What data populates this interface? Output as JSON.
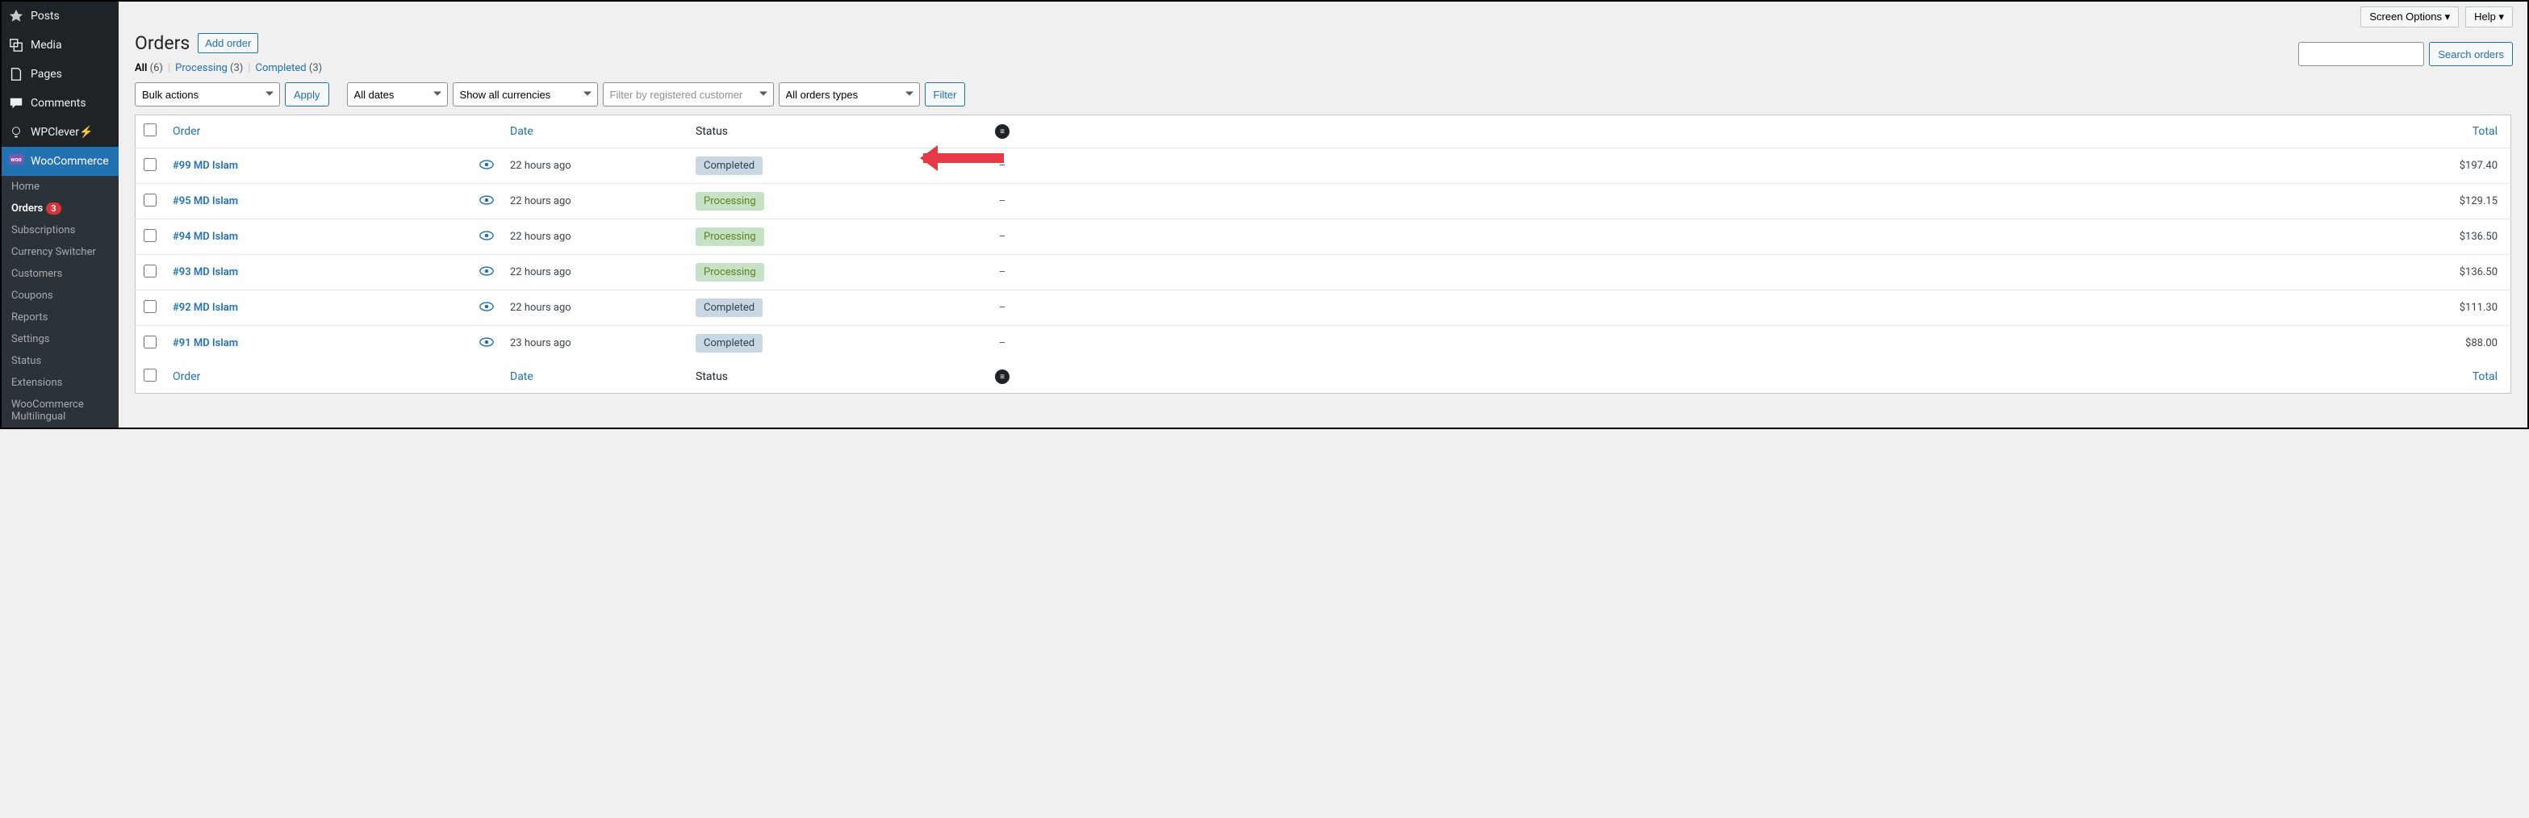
{
  "topbar": {
    "screen_options": "Screen Options ▾",
    "help": "Help ▾"
  },
  "sidebar": {
    "items": [
      {
        "label": "Posts",
        "icon": "pin-icon"
      },
      {
        "label": "Media",
        "icon": "media-icon"
      },
      {
        "label": "Pages",
        "icon": "pages-icon"
      },
      {
        "label": "Comments",
        "icon": "comment-icon"
      },
      {
        "label": "WPClever⚡",
        "icon": "bulb-icon"
      },
      {
        "label": "WooCommerce",
        "icon": "woo-icon",
        "active": true
      }
    ],
    "sub": [
      {
        "label": "Home"
      },
      {
        "label": "Orders",
        "current": true,
        "badge": "3"
      },
      {
        "label": "Subscriptions"
      },
      {
        "label": "Currency Switcher"
      },
      {
        "label": "Customers"
      },
      {
        "label": "Coupons"
      },
      {
        "label": "Reports"
      },
      {
        "label": "Settings"
      },
      {
        "label": "Status"
      },
      {
        "label": "Extensions"
      },
      {
        "label": "WooCommerce Multilingual"
      }
    ]
  },
  "header": {
    "title": "Orders",
    "add": "Add order"
  },
  "subsub": {
    "all": "All",
    "all_count": "(6)",
    "processing": "Processing",
    "processing_count": "(3)",
    "completed": "Completed",
    "completed_count": "(3)"
  },
  "toolbar": {
    "bulk": "Bulk actions",
    "apply": "Apply",
    "dates": "All dates",
    "currencies": "Show all currencies",
    "customer_ph": "Filter by registered customer",
    "types": "All orders types",
    "filter": "Filter"
  },
  "search": {
    "button": "Search orders"
  },
  "columns": {
    "order": "Order",
    "date": "Date",
    "status": "Status",
    "total": "Total"
  },
  "orders": [
    {
      "id": "#99 MD Islam",
      "date": "22 hours ago",
      "status": "Completed",
      "status_class": "completed",
      "misc": "–",
      "total": "$197.40"
    },
    {
      "id": "#95 MD Islam",
      "date": "22 hours ago",
      "status": "Processing",
      "status_class": "processing",
      "misc": "–",
      "total": "$129.15"
    },
    {
      "id": "#94 MD Islam",
      "date": "22 hours ago",
      "status": "Processing",
      "status_class": "processing",
      "misc": "–",
      "total": "$136.50"
    },
    {
      "id": "#93 MD Islam",
      "date": "22 hours ago",
      "status": "Processing",
      "status_class": "processing",
      "misc": "–",
      "total": "$136.50"
    },
    {
      "id": "#92 MD Islam",
      "date": "22 hours ago",
      "status": "Completed",
      "status_class": "completed",
      "misc": "–",
      "total": "$111.30"
    },
    {
      "id": "#91 MD Islam",
      "date": "23 hours ago",
      "status": "Completed",
      "status_class": "completed",
      "misc": "–",
      "total": "$88.00"
    }
  ]
}
